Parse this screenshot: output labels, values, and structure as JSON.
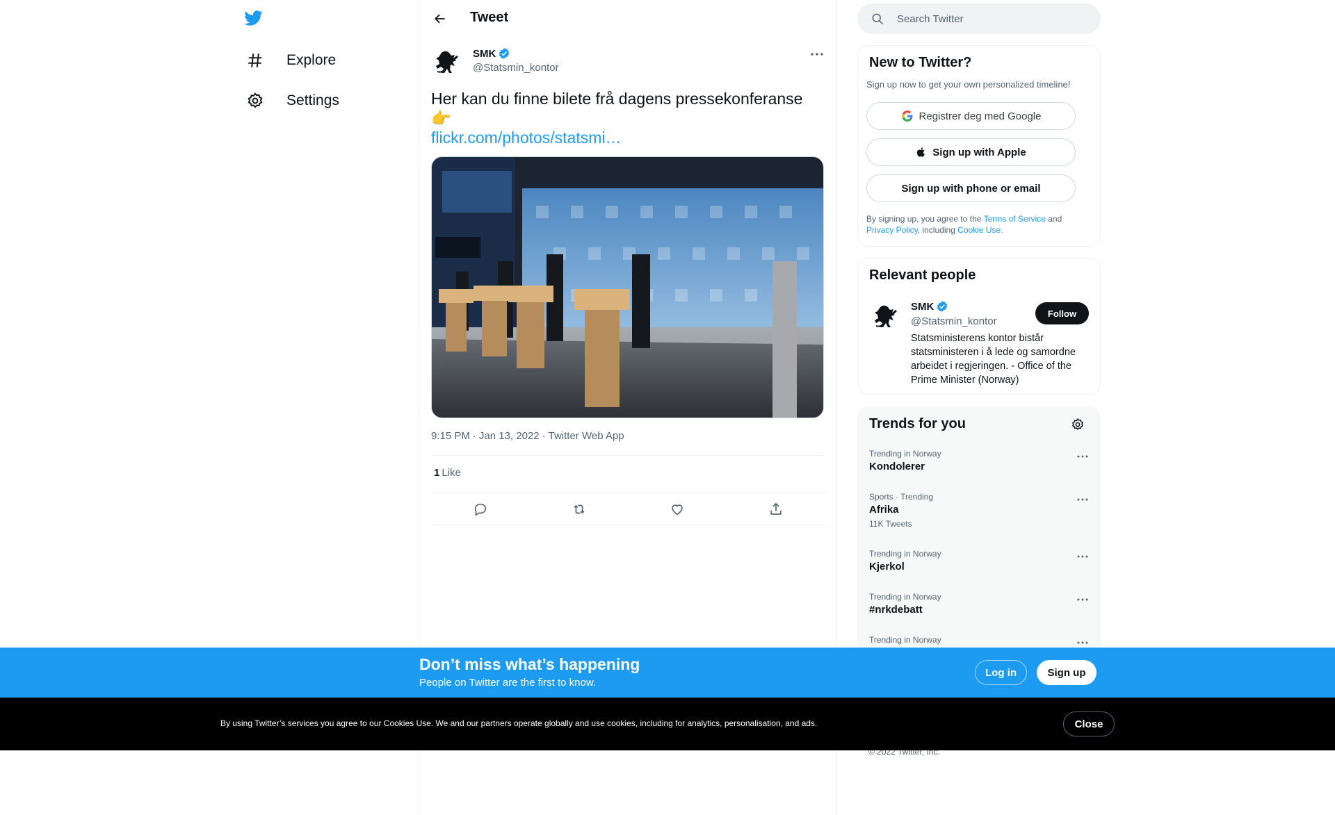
{
  "nav": {
    "items": [
      {
        "label": "Explore",
        "icon": "hashtag-icon"
      },
      {
        "label": "Settings",
        "icon": "gear-icon"
      }
    ]
  },
  "header": {
    "title": "Tweet"
  },
  "tweet": {
    "author_name": "SMK",
    "author_handle": "@Statsmin_kontor",
    "text": "Her kan du finne bilete frå dagens pressekonferanse 👉",
    "link": "flickr.com/photos/statsmi…",
    "time": "9:15 PM",
    "date": "Jan 13, 2022",
    "source": "Twitter Web App",
    "sep": "·",
    "like_count": "1",
    "like_label": "Like"
  },
  "search": {
    "placeholder": "Search Twitter"
  },
  "signup_card": {
    "title": "New to Twitter?",
    "subtitle": "Sign up now to get your own personalized timeline!",
    "google_label": "Registrer deg med Google",
    "apple_label": "Sign up with Apple",
    "phone_label": "Sign up with phone or email",
    "terms_pre": "By signing up, you agree to the ",
    "terms_link": "Terms of Service",
    "terms_and": " and ",
    "privacy_link": "Privacy Policy",
    "terms_including": ", including ",
    "cookie_link": "Cookie Use."
  },
  "people": {
    "title": "Relevant people",
    "name": "SMK",
    "handle": "@Statsmin_kontor",
    "follow_label": "Follow",
    "bio": "Statsministerens kontor bistår statsministeren i å lede og samordne arbeidet i regjeringen. - Office of the Prime Minister (Norway)"
  },
  "trends": {
    "title": "Trends for you",
    "items": [
      {
        "context": "Trending in Norway",
        "name": "Kondolerer",
        "count": ""
      },
      {
        "context": "Sports · Trending",
        "name": "Afrika",
        "count": "11K Tweets"
      },
      {
        "context": "Trending in Norway",
        "name": "Kjerkol",
        "count": ""
      },
      {
        "context": "Trending in Norway",
        "name": "#nrkdebatt",
        "count": ""
      },
      {
        "context": "Trending in Norway",
        "name": "",
        "count": ""
      }
    ]
  },
  "copyright": "© 2022 Twitter, Inc.",
  "promo": {
    "title": "Don’t miss what’s happening",
    "subtitle": "People on Twitter are the first to know.",
    "login_label": "Log in",
    "signup_label": "Sign up"
  },
  "cookie": {
    "text": "By using Twitter’s services you agree to our Cookies Use. We and our partners operate globally and use cookies, including for analytics, personalisation, and ads.",
    "close_label": "Close"
  },
  "colors": {
    "accent": "#1d9bf0",
    "text": "#0f1419",
    "secondary": "#536471"
  }
}
